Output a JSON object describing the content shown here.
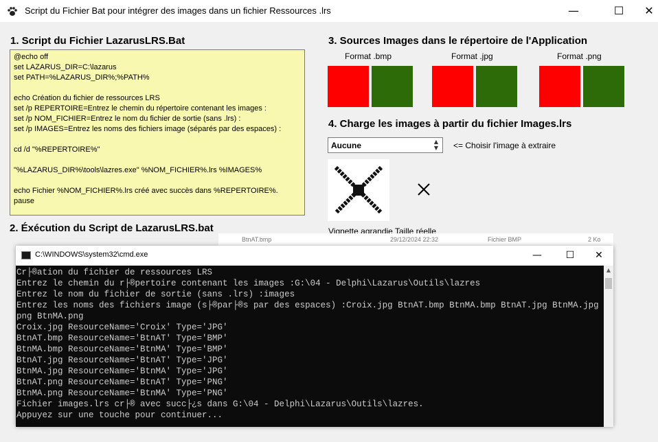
{
  "window": {
    "title": "Script du Fichier  Bat pour intégrer des images  dans un fichier Ressources .lrs",
    "minimize_glyph": "—",
    "maximize_glyph": "☐",
    "close_glyph": "✕"
  },
  "section1": {
    "title": "1. Script du Fichier  LazarusLRS.Bat",
    "lines": [
      "@echo off",
      "set LAZARUS_DIR=C:\\lazarus",
      "set PATH=%LAZARUS_DIR%;%PATH%",
      "",
      "echo Création du fichier de ressources LRS",
      "set /p REPERTOIRE=Entrez le chemin du répertoire contenant les images :",
      "set /p NOM_FICHIER=Entrez le nom du fichier de sortie (sans .lrs) :",
      "set /p IMAGES=Entrez les noms des fichiers image (séparés par des espaces) :",
      "",
      "cd /d \"%REPERTOIRE%\"",
      "",
      "\"%LAZARUS_DIR%\\tools\\lazres.exe\" %NOM_FICHIER%.lrs %IMAGES%",
      "",
      "echo Fichier %NOM_FICHIER%.lrs créé avec succès dans %REPERTOIRE%.",
      "pause"
    ]
  },
  "section2": {
    "title": "2. Éxécution du Script de LazarusLRS.bat"
  },
  "section3": {
    "title": "3. Sources Images dans le répertoire de l'Application",
    "formats": [
      {
        "label": "Format .bmp"
      },
      {
        "label": "Format .jpg"
      },
      {
        "label": "Format .png"
      }
    ],
    "colors": {
      "red": "#ff0000",
      "green": "#2d6a08"
    }
  },
  "section4": {
    "title": "4. Charge les images à partir du fichier Images.lrs",
    "combo_value": "Aucune",
    "hint": "<= Choisir l'image à extraire",
    "vignette_caption": "Vignette agrandie Taille réelle",
    "vignette_icon": "cross-icon"
  },
  "background_listing": {
    "name": "BtnAT.bmp",
    "date": "29/12/2024 22:32",
    "type": "Fichier BMP",
    "size": "2 Ko"
  },
  "cmd": {
    "title": "C:\\WINDOWS\\system32\\cmd.exe",
    "lines": [
      "Cr├®ation du fichier de ressources LRS",
      "Entrez le chemin du r├®pertoire contenant les images :G:\\04 - Delphi\\Lazarus\\Outils\\lazres",
      "Entrez le nom du fichier de sortie (sans .lrs) :images",
      "Entrez les noms des fichiers image (s├®par├®s par des espaces) :Croix.jpg BtnAT.bmp BtnMA.bmp BtnAT.jpg BtnMA.jpg BtnAT.",
      "png BtnMA.png",
      "Croix.jpg ResourceName='Croix' Type='JPG'",
      "BtnAT.bmp ResourceName='BtnAT' Type='BMP'",
      "BtnMA.bmp ResourceName='BtnMA' Type='BMP'",
      "BtnAT.jpg ResourceName='BtnAT' Type='JPG'",
      "BtnMA.jpg ResourceName='BtnMA' Type='JPG'",
      "BtnAT.png ResourceName='BtnAT' Type='PNG'",
      "BtnMA.png ResourceName='BtnMA' Type='PNG'",
      "Fichier images.lrs cr├® avec succ├¿s dans G:\\04 - Delphi\\Lazarus\\Outils\\lazres.",
      "Appuyez sur une touche pour continuer..."
    ]
  }
}
